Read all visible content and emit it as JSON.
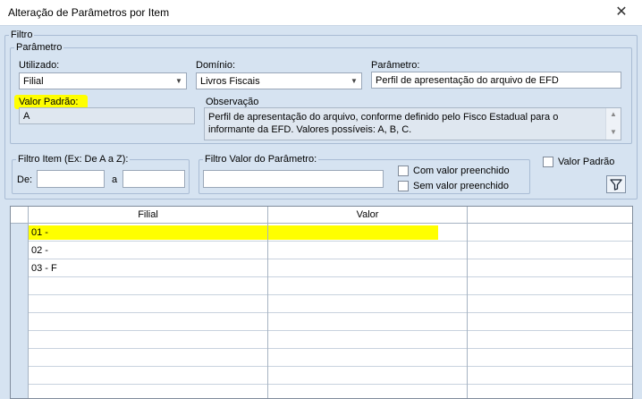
{
  "window": {
    "title": "Alteração de Parâmetros por Item",
    "close_glyph": "✕"
  },
  "filtro": {
    "legend": "Filtro",
    "parametro_group": {
      "legend": "Parâmetro",
      "utilizado": {
        "label": "Utilizado:",
        "value": "Filial"
      },
      "dominio": {
        "label": "Domínio:",
        "value": "Livros Fiscais"
      },
      "parametro": {
        "label": "Parâmetro:",
        "value": "Perfil de apresentação do arquivo de EFD"
      },
      "valor_padrao": {
        "label": "Valor Padrão:",
        "value": "A"
      },
      "observacao": {
        "label": "Observação",
        "text": "Perfil de apresentação do arquivo, conforme definido pelo Fisco Estadual para o informante da EFD. Valores possíveis: A, B, C."
      }
    },
    "filtro_item": {
      "legend": "Filtro Item (Ex: De A a Z):",
      "de_label": "De:",
      "a_label": "a",
      "de_value": "",
      "a_value": ""
    },
    "filtro_valor": {
      "legend": "Filtro Valor do Parâmetro:",
      "value": "",
      "com_valor": "Com valor preenchido",
      "sem_valor": "Sem valor preenchido"
    },
    "valor_padrao_checkbox": "Valor Padrão",
    "highlight_color": "#ffff00"
  },
  "grid": {
    "columns": [
      "Filial",
      "Valor"
    ],
    "rows": [
      {
        "filial": "01 -",
        "valor": ""
      },
      {
        "filial": "02 -",
        "valor": ""
      },
      {
        "filial": "03 - F",
        "valor": ""
      },
      {
        "filial": "",
        "valor": ""
      },
      {
        "filial": "",
        "valor": ""
      },
      {
        "filial": "",
        "valor": ""
      },
      {
        "filial": "",
        "valor": ""
      },
      {
        "filial": "",
        "valor": ""
      },
      {
        "filial": "",
        "valor": ""
      },
      {
        "filial": "",
        "valor": ""
      }
    ]
  }
}
